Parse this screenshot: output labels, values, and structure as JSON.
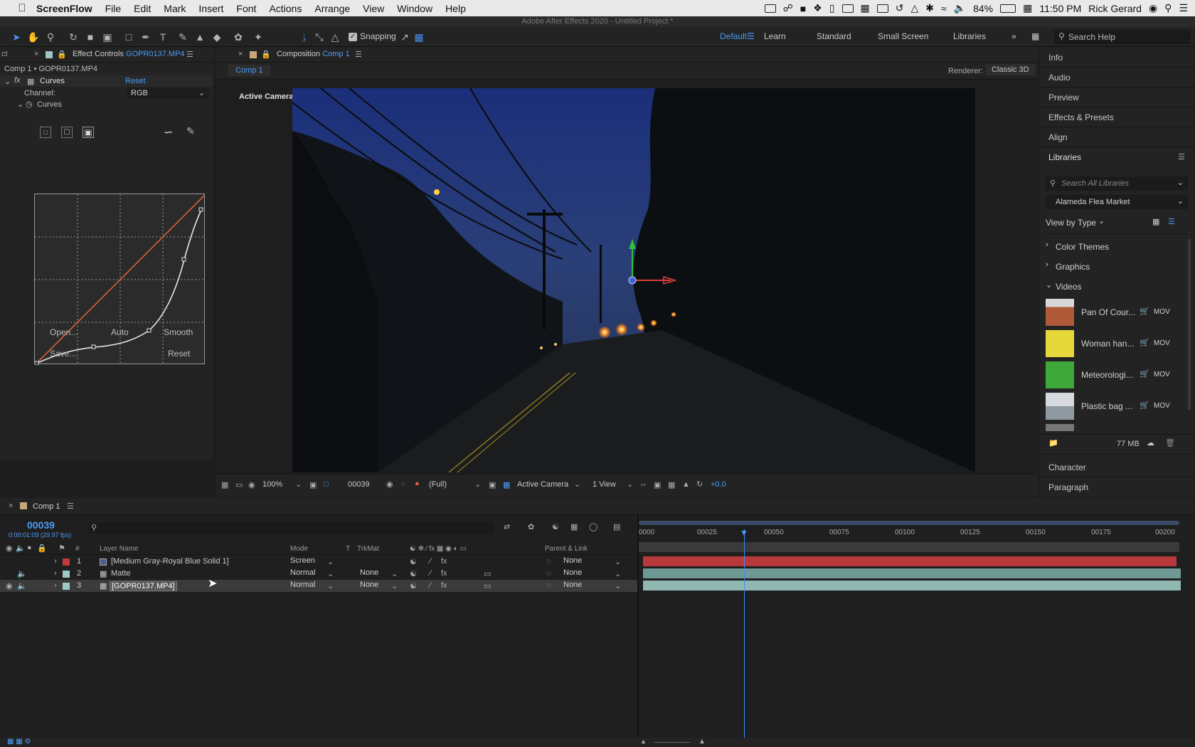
{
  "menubar": {
    "app": "ScreenFlow",
    "items": [
      "File",
      "Edit",
      "Mark",
      "Insert",
      "Font",
      "Actions",
      "Arrange",
      "View",
      "Window",
      "Help"
    ],
    "battery": "84%",
    "time": "11:50 PM",
    "user": "Rick Gerard"
  },
  "window_title": "Adobe After Effects 2020 - Untitled Project *",
  "toolbar": {
    "snapping_label": "Snapping",
    "workspaces": [
      "Default",
      "Learn",
      "Standard",
      "Small Screen",
      "Libraries"
    ],
    "active_workspace": "Default",
    "search_placeholder": "Search Help"
  },
  "effect_controls": {
    "prev_tab": "ct",
    "tab_label": "Effect Controls",
    "tab_file": "GOPR0137.MP4",
    "breadcrumb": "Comp 1 • GOPR0137.MP4",
    "effect_name": "Curves",
    "reset": "Reset",
    "channel_label": "Channel:",
    "channel_value": "RGB",
    "curves_label": "Curves",
    "buttons": {
      "open": "Open...",
      "auto": "Auto",
      "smooth": "Smooth",
      "save": "Save...",
      "reset": "Reset"
    }
  },
  "composition": {
    "tab_prefix": "Composition",
    "tab_name": "Comp 1",
    "sub_tab": "Comp 1",
    "renderer_label": "Renderer:",
    "renderer_value": "Classic 3D",
    "view_label": "Active Camera",
    "footer": {
      "zoom": "100%",
      "frame": "00039",
      "resolution": "(Full)",
      "camera": "Active Camera",
      "views": "1 View",
      "exposure": "+0.0"
    }
  },
  "right_panel": {
    "items": [
      "Info",
      "Audio",
      "Preview",
      "Effects & Presets",
      "Align"
    ],
    "libraries_title": "Libraries",
    "search_placeholder": "Search All Libraries",
    "library_name": "Alameda Flea Market",
    "view_by": "View by Type",
    "groups": [
      "Color Themes",
      "Graphics",
      "Videos"
    ],
    "videos": [
      {
        "name": "Pan Of Cour...",
        "type": "MOV",
        "color": "#b05a3a"
      },
      {
        "name": "Woman han...",
        "type": "MOV",
        "color": "#e6d83a"
      },
      {
        "name": "Meteorologi...",
        "type": "MOV",
        "color": "#3fa83a"
      },
      {
        "name": "Plastic bag ...",
        "type": "MOV",
        "color": "#8f9aa0"
      }
    ],
    "storage": "77 MB",
    "bottom_items": [
      "Character",
      "Paragraph"
    ]
  },
  "timeline": {
    "tab_name": "Comp 1",
    "timecode": "00039",
    "timecode_sub": "0:00:01:09 (29.97 fps)",
    "search_placeholder": "",
    "col_headers": {
      "num": "#",
      "name": "Layer Name",
      "mode": "Mode",
      "t": "T",
      "trkmat": "TrkMat",
      "parent": "Parent & Link"
    },
    "layers": [
      {
        "num": "1",
        "name": "[Medium Gray-Royal Blue Solid 1]",
        "mode": "Screen",
        "trkmat": "",
        "parent": "None",
        "label_color": "#c0393b",
        "bar_color": "#b8393b"
      },
      {
        "num": "2",
        "name": "Matte",
        "mode": "Normal",
        "trkmat": "None",
        "parent": "None",
        "label_color": "#9ec8c4",
        "bar_color": "#6f9994"
      },
      {
        "num": "3",
        "name": "[GOPR0137.MP4]",
        "mode": "Normal",
        "trkmat": "None",
        "parent": "None",
        "label_color": "#9ec8c4",
        "bar_color": "#8fb8b3"
      }
    ],
    "ruler": [
      "0000",
      "00025",
      "00050",
      "00075",
      "00100",
      "00125",
      "00150",
      "00175",
      "00200"
    ]
  }
}
